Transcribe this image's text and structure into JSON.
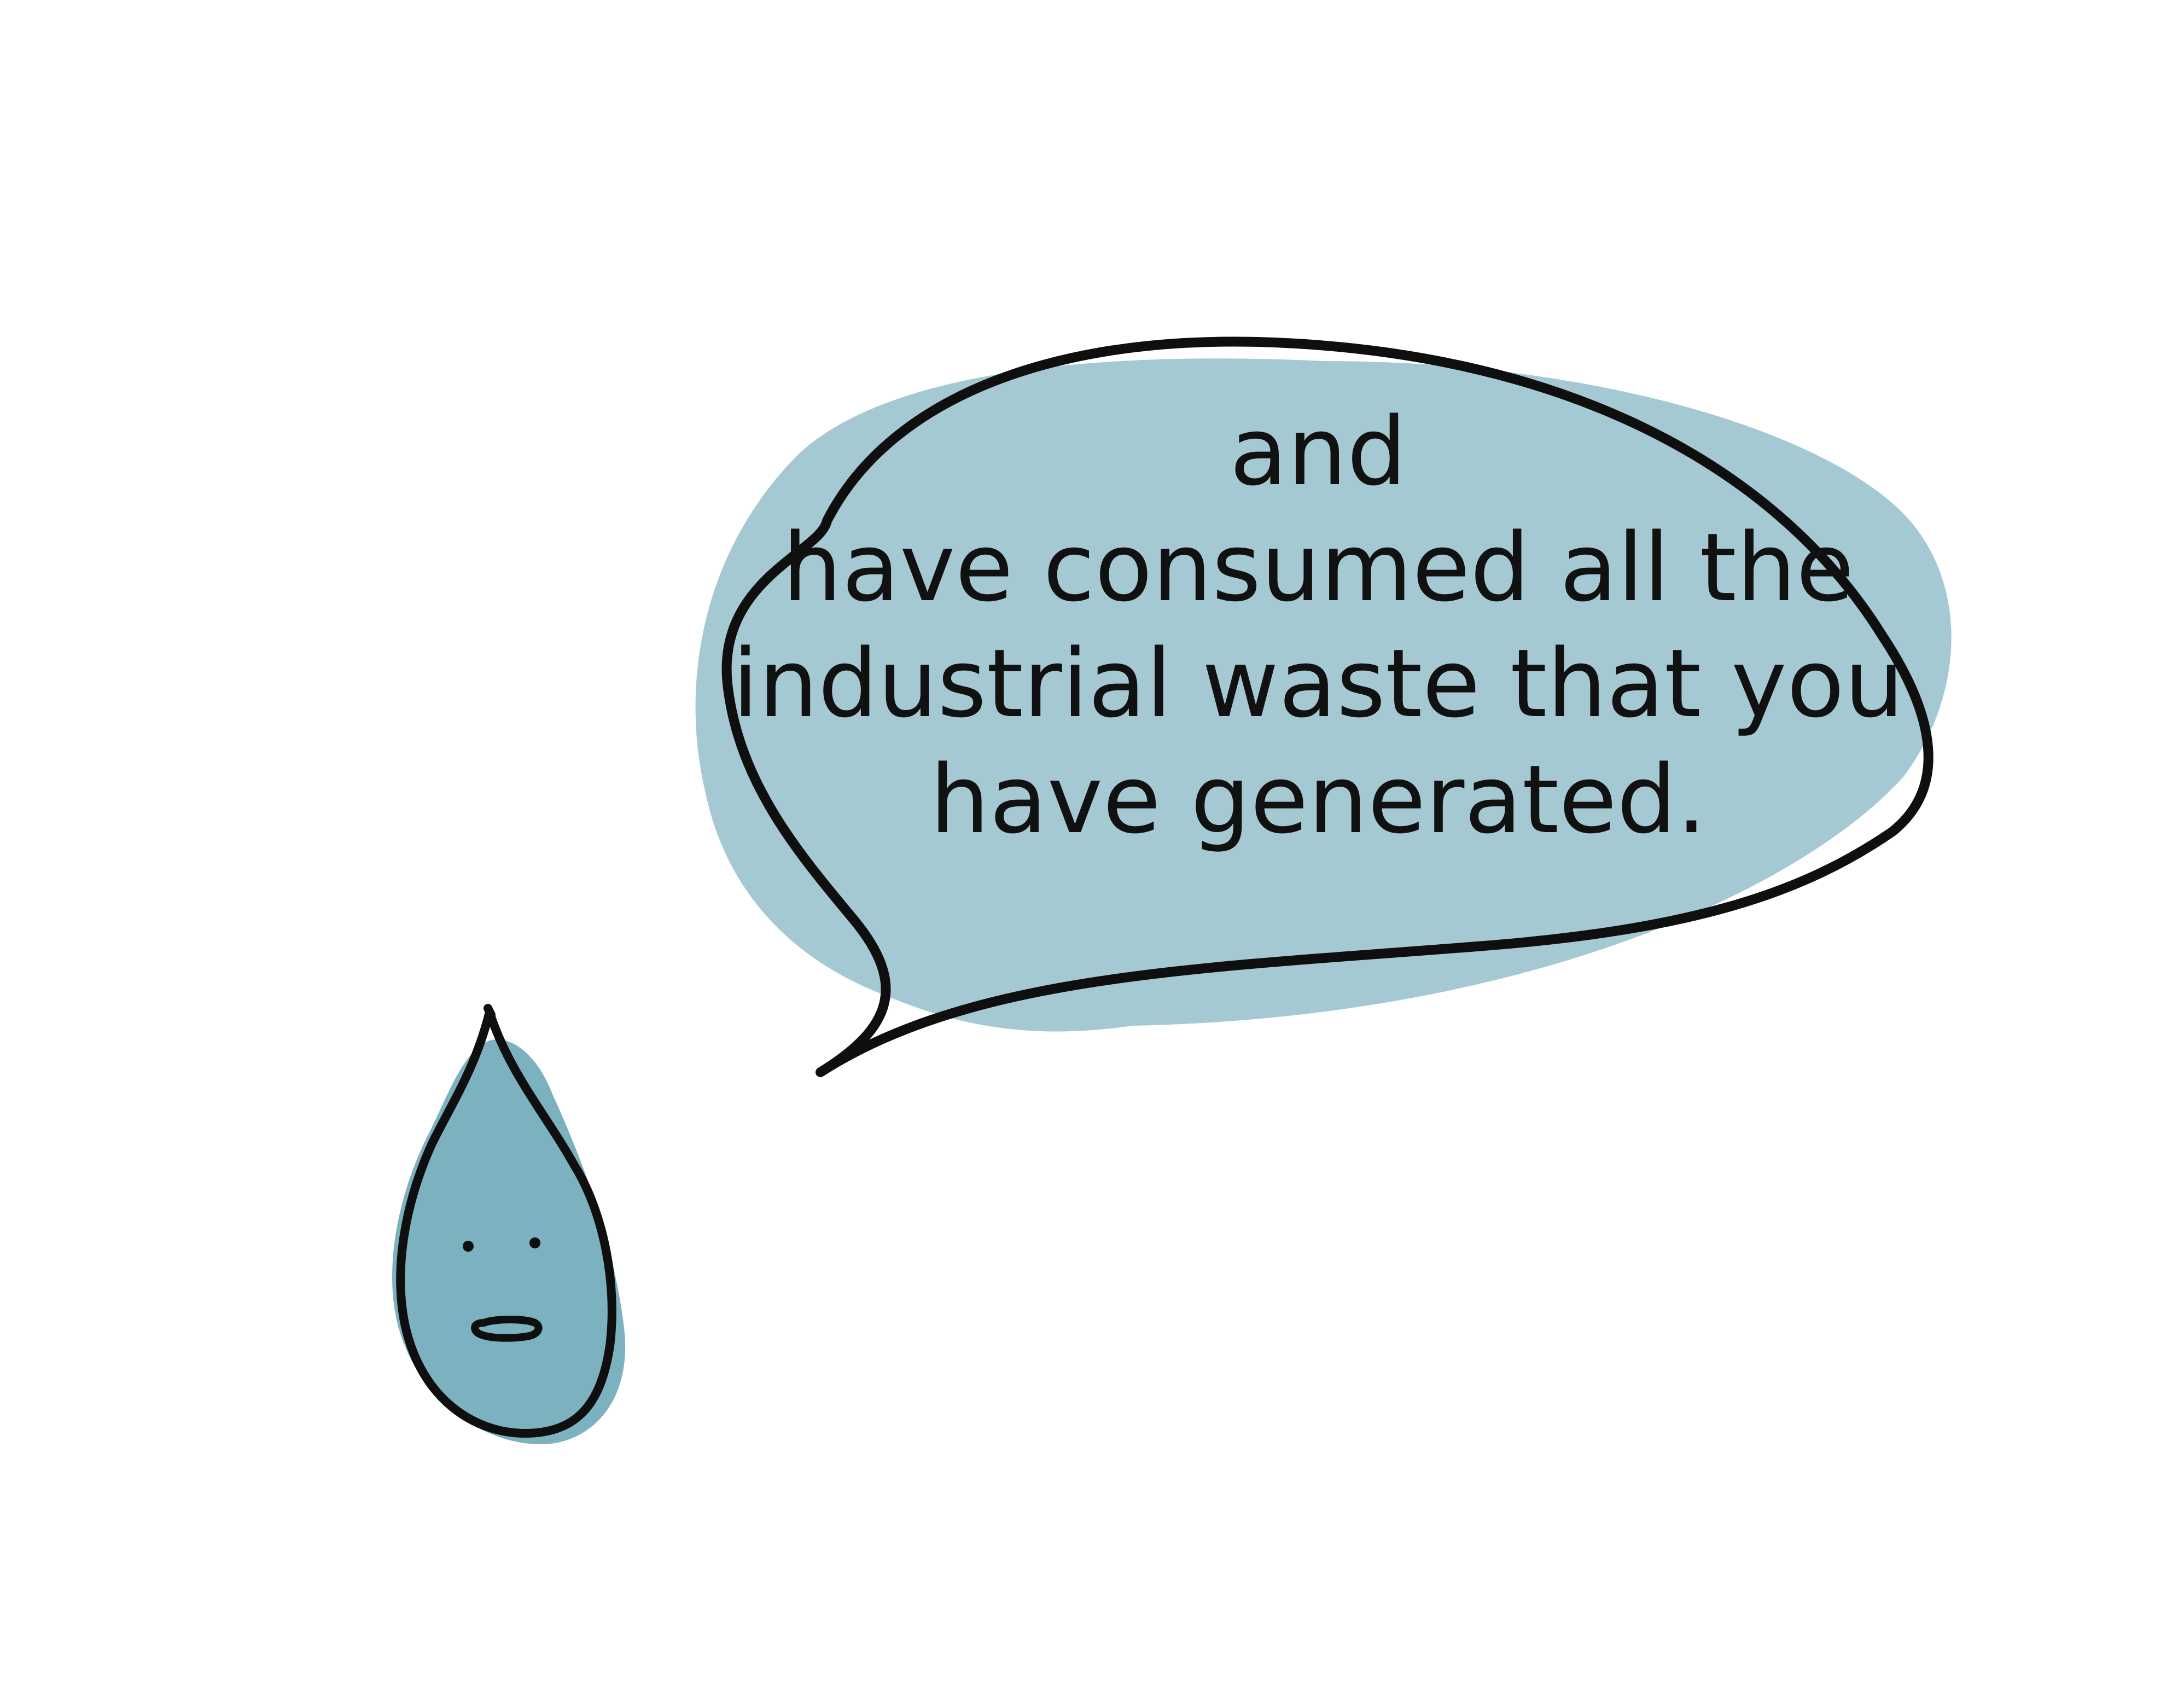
{
  "speech_bubble": {
    "lines": [
      "and",
      "have consumed all the",
      "industrial waste that you",
      "have generated."
    ]
  },
  "colors": {
    "background": "#ffffff",
    "bubble_fill": "#a5c9d3",
    "drop_fill": "#7cb1c0",
    "outline": "#0f0f0f"
  },
  "icons": {
    "character": "water-drop-icon"
  }
}
